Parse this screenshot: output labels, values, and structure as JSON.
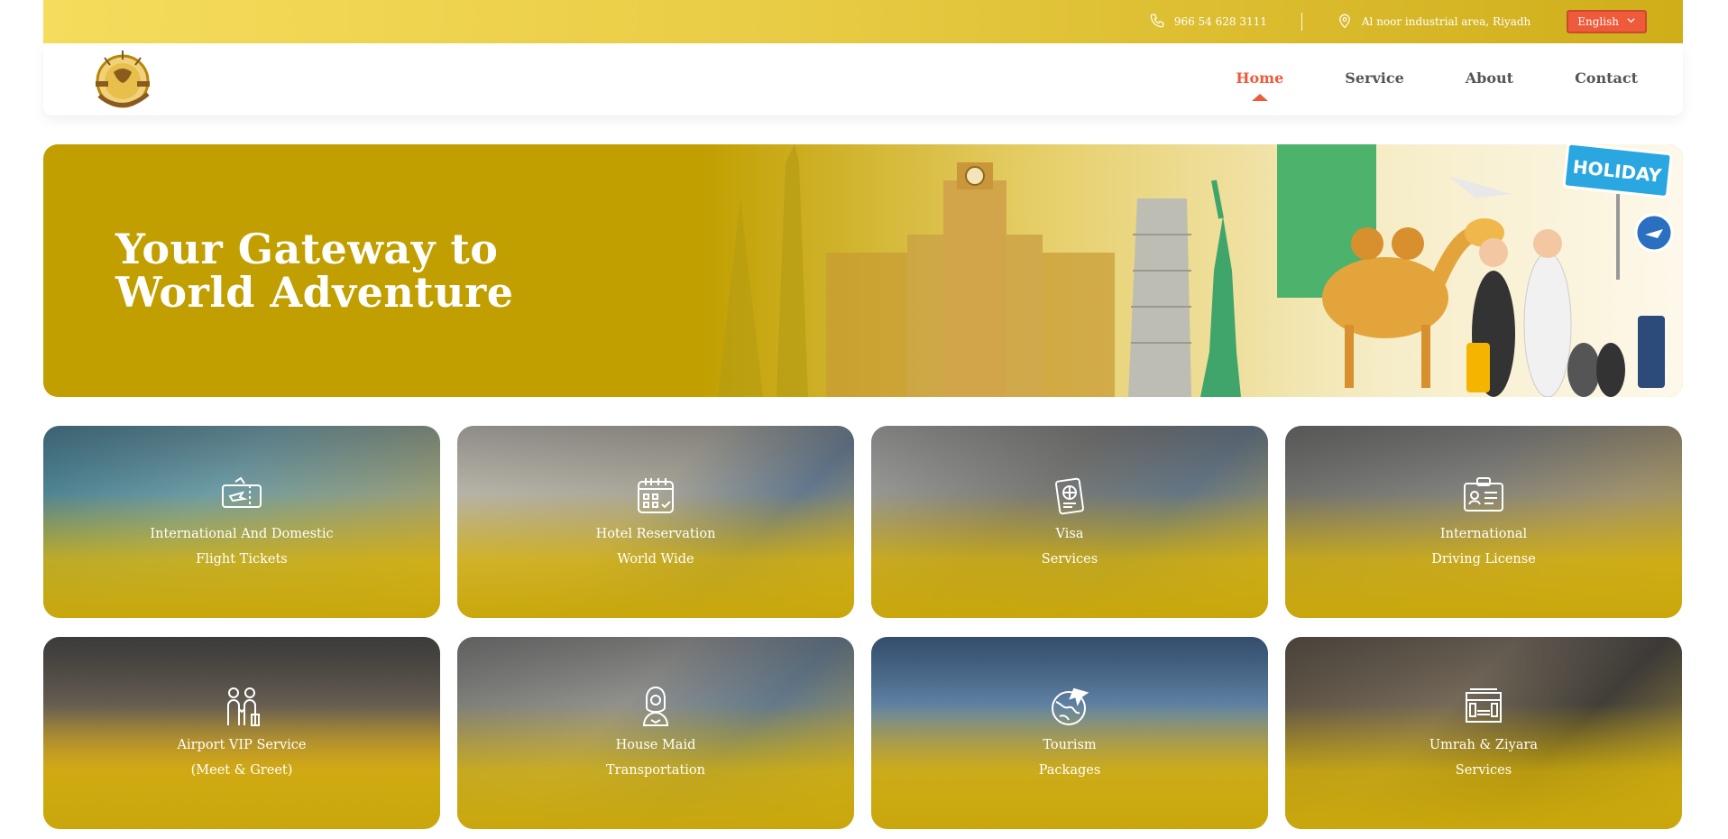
{
  "topbar": {
    "phone": "966 54 628 3111",
    "address": "Al noor industrial area, Riyadh",
    "language": "English"
  },
  "nav": {
    "items": [
      {
        "label": "Home",
        "active": true
      },
      {
        "label": "Service",
        "active": false
      },
      {
        "label": "About",
        "active": false
      },
      {
        "label": "Contact",
        "active": false
      }
    ]
  },
  "hero": {
    "line1": "Your Gateway to",
    "line2": "World Adventure",
    "sign_text": "HOLIDAY"
  },
  "services": [
    {
      "line1": "International And Domestic",
      "line2": "Flight Tickets",
      "icon": "plane-ticket-icon"
    },
    {
      "line1": "Hotel Reservation",
      "line2": "World Wide",
      "icon": "calendar-icon"
    },
    {
      "line1": "Visa",
      "line2": "Services",
      "icon": "passport-icon"
    },
    {
      "line1": "International",
      "line2": "Driving License",
      "icon": "id-card-icon"
    },
    {
      "line1": "Airport VIP Service",
      "line2": "(Meet & Greet)",
      "icon": "meet-greet-icon"
    },
    {
      "line1": "House Maid",
      "line2": "Transportation",
      "icon": "maid-icon"
    },
    {
      "line1": "Tourism",
      "line2": "Packages",
      "icon": "globe-plane-icon"
    },
    {
      "line1": "Umrah & Ziyara",
      "line2": "Services",
      "icon": "kaaba-icon"
    }
  ],
  "colors": {
    "gold": "#c19f00",
    "accent": "#ee5a3a",
    "nav_text": "#555555"
  }
}
